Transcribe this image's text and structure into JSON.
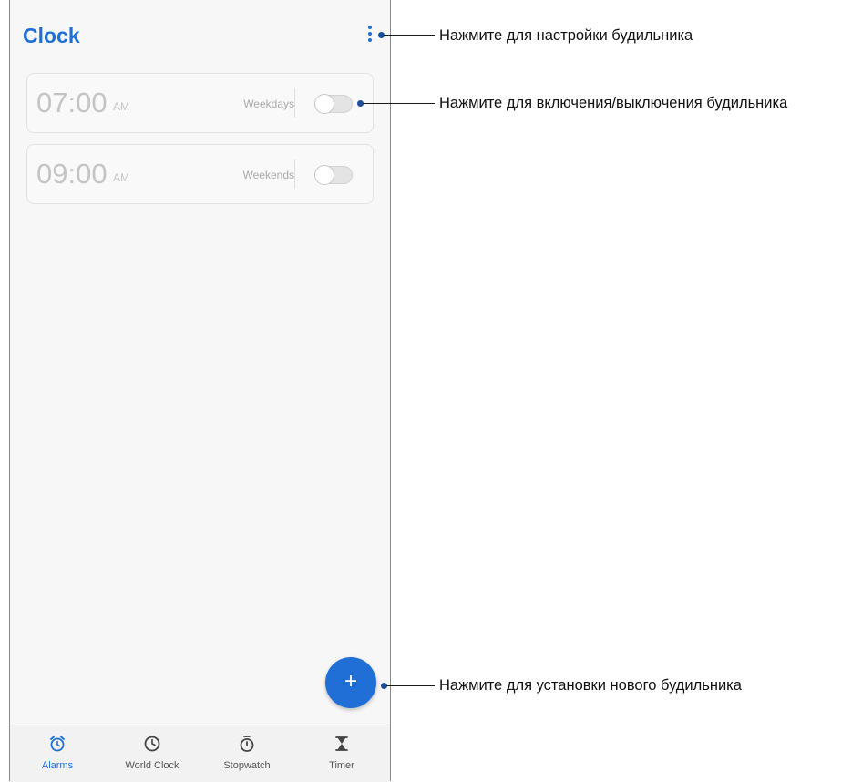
{
  "app": {
    "title": "Clock"
  },
  "alarms": [
    {
      "time": "07:00",
      "ampm": "AM",
      "days": "Weekdays",
      "enabled": false
    },
    {
      "time": "09:00",
      "ampm": "AM",
      "days": "Weekends",
      "enabled": false
    }
  ],
  "fab": {
    "label": "+"
  },
  "nav": [
    {
      "label": "Alarms",
      "icon": "alarm-clock-icon",
      "active": true
    },
    {
      "label": "World Clock",
      "icon": "clock-icon",
      "active": false
    },
    {
      "label": "Stopwatch",
      "icon": "stopwatch-icon",
      "active": false
    },
    {
      "label": "Timer",
      "icon": "hourglass-icon",
      "active": false
    }
  ],
  "callouts": {
    "menu": "Нажмите для настройки будильника",
    "toggle": "Нажмите для включения/выключения будильника",
    "add": "Нажмите для установки нового будильника"
  },
  "colors": {
    "accent": "#1f6fd6",
    "callout_dot": "#1a4f9c"
  }
}
